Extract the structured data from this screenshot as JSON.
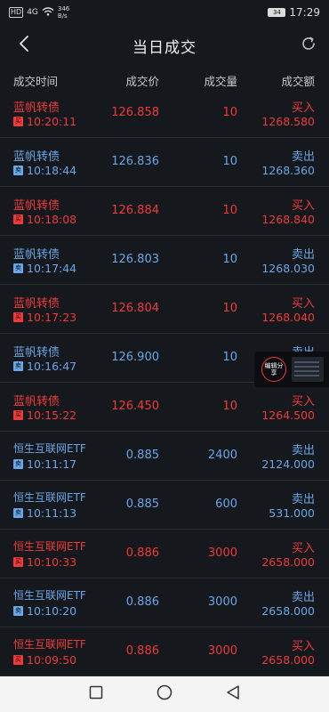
{
  "status_bar": {
    "hd": "HD",
    "signal": "4G",
    "net_speed_value": "346",
    "net_speed_unit": "B/s",
    "battery": "34",
    "time": "17:29"
  },
  "header": {
    "title": "当日成交",
    "back_icon": "chevron-left-icon",
    "refresh_icon": "refresh-icon"
  },
  "columns": {
    "time": "成交时间",
    "price": "成交价",
    "volume": "成交量",
    "amount": "成交额"
  },
  "colors": {
    "buy": "#f03a3a",
    "sell": "#6aa6e6",
    "background": "#15181d"
  },
  "rows": [
    {
      "name": "蓝帆转债",
      "badge": "买",
      "time": "10:20:11",
      "price": "126.858",
      "volume": "10",
      "side": "买入",
      "amount": "1268.580",
      "type": "buy"
    },
    {
      "name": "蓝帆转债",
      "badge": "卖",
      "time": "10:18:44",
      "price": "126.836",
      "volume": "10",
      "side": "卖出",
      "amount": "1268.360",
      "type": "sell"
    },
    {
      "name": "蓝帆转债",
      "badge": "买",
      "time": "10:18:08",
      "price": "126.884",
      "volume": "10",
      "side": "买入",
      "amount": "1268.840",
      "type": "buy"
    },
    {
      "name": "蓝帆转债",
      "badge": "卖",
      "time": "10:17:44",
      "price": "126.803",
      "volume": "10",
      "side": "卖出",
      "amount": "1268.030",
      "type": "sell"
    },
    {
      "name": "蓝帆转债",
      "badge": "买",
      "time": "10:17:23",
      "price": "126.804",
      "volume": "10",
      "side": "买入",
      "amount": "1268.040",
      "type": "buy"
    },
    {
      "name": "蓝帆转债",
      "badge": "卖",
      "time": "10:16:47",
      "price": "126.900",
      "volume": "10",
      "side": "卖出",
      "amount": "",
      "type": "sell"
    },
    {
      "name": "蓝帆转债",
      "badge": "买",
      "time": "10:15:22",
      "price": "126.450",
      "volume": "10",
      "side": "买入",
      "amount": "1264.500",
      "type": "buy"
    },
    {
      "name": "恒生互联网ETF",
      "badge": "卖",
      "time": "10:11:17",
      "price": "0.885",
      "volume": "2400",
      "side": "卖出",
      "amount": "2124.000",
      "type": "sell"
    },
    {
      "name": "恒生互联网ETF",
      "badge": "卖",
      "time": "10:11:13",
      "price": "0.885",
      "volume": "600",
      "side": "卖出",
      "amount": "531.000",
      "type": "sell"
    },
    {
      "name": "恒生互联网ETF",
      "badge": "买",
      "time": "10:10:33",
      "price": "0.886",
      "volume": "3000",
      "side": "买入",
      "amount": "2658.000",
      "type": "buy"
    },
    {
      "name": "恒生互联网ETF",
      "badge": "卖",
      "time": "10:10:20",
      "price": "0.886",
      "volume": "3000",
      "side": "卖出",
      "amount": "2658.000",
      "type": "sell"
    },
    {
      "name": "恒生互联网ETF",
      "badge": "买",
      "time": "10:09:50",
      "price": "0.886",
      "volume": "3000",
      "side": "买入",
      "amount": "2658.000",
      "type": "buy"
    }
  ],
  "float_widget": {
    "label": "编辑分享"
  },
  "nav": {
    "recents_icon": "square-icon",
    "home_icon": "circle-icon",
    "back_icon": "triangle-back-icon"
  }
}
